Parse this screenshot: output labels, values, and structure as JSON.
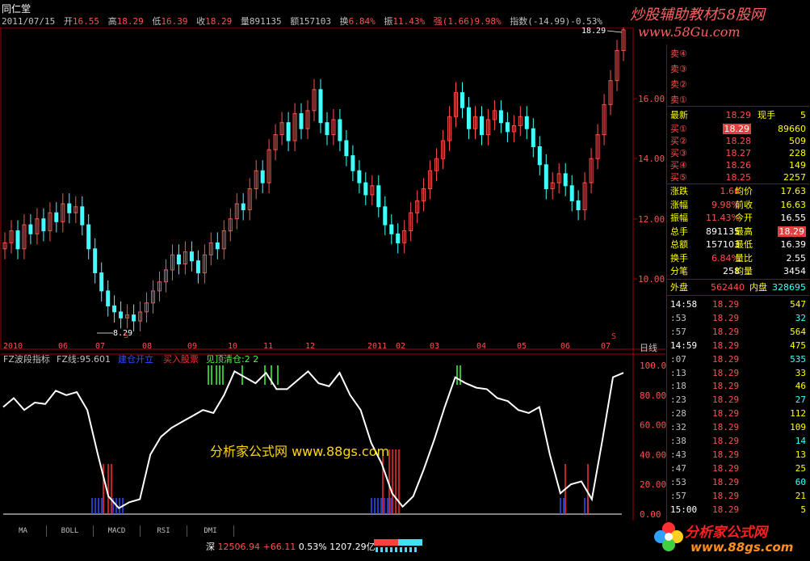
{
  "title": "同仁堂",
  "info": {
    "date": "2011/07/15",
    "open_label": "开",
    "open": "16.55",
    "high_label": "高",
    "high": "18.29",
    "low_label": "低",
    "low": "16.39",
    "close_label": "收",
    "close": "18.29",
    "vol_label": "量",
    "vol": "891135",
    "amt_label": "额",
    "amt": "157103",
    "turn_label": "换",
    "turn": "6.84%",
    "amp_label": "振",
    "amp": "11.43%",
    "strong_label": "强",
    "strong": "(1.66)9.98%",
    "index_label": "指数",
    "index": "(-14.99)-0.53%"
  },
  "watermark": {
    "line1": "炒股辅助教材58股网",
    "line2": "www.58Gu.com"
  },
  "main_chart": {
    "price_axis": [
      "16.00",
      "14.00",
      "12.00",
      "10.00"
    ],
    "high_marker": "18.29",
    "low_marker": "8.29",
    "month_labels": [
      "2010",
      "06",
      "07",
      "08",
      "09",
      "10",
      "11",
      "12",
      "2011",
      "02",
      "03",
      "04",
      "05",
      "06",
      "07"
    ],
    "period_label": "日线",
    "s_marker": "S"
  },
  "indicator": {
    "name": "FZ波段指标",
    "value_label": "FZ线:95.601",
    "legend_blue": "建仓开立",
    "legend_red": "买入股票",
    "legend_green": "见顶清仓:2 2",
    "axis": [
      "100.00",
      "80.00",
      "60.00",
      "40.00",
      "20.00",
      "0.00"
    ],
    "watermark": "分析家公式网 www.88gs.com"
  },
  "chart_data": {
    "type": "line",
    "title": "FZ波段指标",
    "ylim": [
      0,
      100
    ],
    "series": [
      {
        "name": "FZ线",
        "values": [
          72,
          78,
          70,
          75,
          74,
          83,
          80,
          82,
          70,
          40,
          12,
          4,
          8,
          10,
          40,
          52,
          58,
          62,
          66,
          70,
          68,
          80,
          96,
          92,
          88,
          95,
          84,
          84,
          90,
          96,
          88,
          86,
          95,
          80,
          70,
          48,
          34,
          14,
          5,
          12,
          30,
          50,
          72,
          92,
          88,
          85,
          84,
          78,
          76,
          70,
          68,
          72,
          40,
          14,
          20,
          22,
          10,
          50,
          92,
          95
        ]
      }
    ]
  },
  "quote": {
    "sell": [
      "卖④",
      "卖③",
      "卖②",
      "卖①"
    ],
    "latest_label": "最新",
    "latest": "18.29",
    "now_hand_label": "现手",
    "now_hand": "5",
    "buys": [
      {
        "label": "买①",
        "price": "18.29",
        "vol": "89660"
      },
      {
        "label": "买②",
        "price": "18.28",
        "vol": "509"
      },
      {
        "label": "买③",
        "price": "18.27",
        "vol": "228"
      },
      {
        "label": "买④",
        "price": "18.26",
        "vol": "149"
      },
      {
        "label": "买⑤",
        "price": "18.25",
        "vol": "2257"
      }
    ],
    "stats": [
      {
        "k1": "涨跌",
        "v1": "1.66",
        "k2": "均价",
        "v2": "17.63"
      },
      {
        "k1": "涨幅",
        "v1": "9.98%",
        "k2": "前收",
        "v2": "16.63"
      },
      {
        "k1": "振幅",
        "v1": "11.43%",
        "k2": "今开",
        "v2": "16.55"
      },
      {
        "k1": "总手",
        "v1": "891135",
        "k2": "最高",
        "v2": "18.29"
      },
      {
        "k1": "总额",
        "v1": "157103",
        "k2": "最低",
        "v2": "16.39"
      },
      {
        "k1": "换手",
        "v1": "6.84%",
        "k2": "量比",
        "v2": "2.55"
      },
      {
        "k1": "分笔",
        "v1": "258",
        "k2": "均量",
        "v2": "3454"
      }
    ],
    "outer_label": "外盘",
    "outer": "562440",
    "inner_label": "内盘",
    "inner": "328695"
  },
  "ticks": [
    {
      "t": "14:58",
      "p": "18.29",
      "q": "547"
    },
    {
      "t": ":53",
      "p": "18.29",
      "q": "32"
    },
    {
      "t": ":57",
      "p": "18.29",
      "q": "564"
    },
    {
      "t": "14:59",
      "p": "18.29",
      "q": "475"
    },
    {
      "t": ":07",
      "p": "18.29",
      "q": "535"
    },
    {
      "t": ":13",
      "p": "18.29",
      "q": "33"
    },
    {
      "t": ":18",
      "p": "18.29",
      "q": "46"
    },
    {
      "t": ":23",
      "p": "18.29",
      "q": "27"
    },
    {
      "t": ":28",
      "p": "18.29",
      "q": "112"
    },
    {
      "t": ":32",
      "p": "18.29",
      "q": "109"
    },
    {
      "t": ":38",
      "p": "18.29",
      "q": "14"
    },
    {
      "t": ":43",
      "p": "18.29",
      "q": "13"
    },
    {
      "t": ":47",
      "p": "18.29",
      "q": "25"
    },
    {
      "t": ":53",
      "p": "18.29",
      "q": "60"
    },
    {
      "t": ":57",
      "p": "18.29",
      "q": "21"
    },
    {
      "t": "15:00",
      "p": "18.29",
      "q": "5"
    }
  ],
  "tabs": [
    "MA",
    "BOLL",
    "MACD",
    "RSI",
    "DMI"
  ],
  "status": {
    "market": "深",
    "index": "12506.94",
    "change": "+66.11",
    "pct": "0.53%",
    "amount": "1207.29亿"
  },
  "logo": {
    "name": "分析家公式网",
    "url": "www.88gs.com"
  },
  "colors": {
    "up": "#ff5050",
    "down": "#40ffff",
    "frame": "#a00000",
    "line": "#ffffff"
  }
}
